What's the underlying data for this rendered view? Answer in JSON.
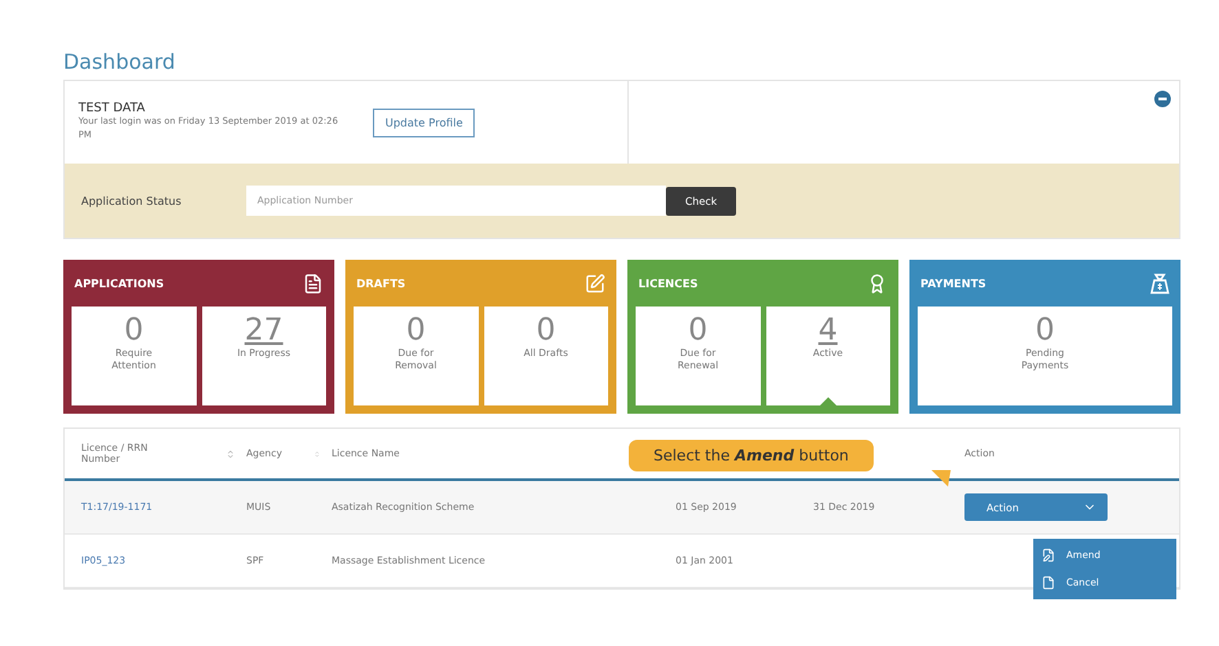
{
  "page_title": "Dashboard",
  "profile": {
    "name": "TEST DATA",
    "last_login": "Your last login was on Friday 13 September 2019 at 02:26 PM",
    "button": "Update Profile"
  },
  "status_check": {
    "label": "Application Status",
    "placeholder": "Application Number",
    "button": "Check"
  },
  "tiles": [
    {
      "title": "APPLICATIONS",
      "color": "#8e2a3a",
      "stats": [
        {
          "value": "0",
          "label": "Require Attention",
          "kind": "plain",
          "selected": false
        },
        {
          "value": "27",
          "label": "In Progress",
          "kind": "link",
          "selected": false
        }
      ]
    },
    {
      "title": "DRAFTS",
      "color": "#e0a02a",
      "stats": [
        {
          "value": "0",
          "label": "Due for Removal",
          "kind": "plain",
          "selected": false
        },
        {
          "value": "0",
          "label": "All Drafts",
          "kind": "plain",
          "selected": false
        }
      ]
    },
    {
      "title": "LICENCES",
      "color": "#5fa544",
      "stats": [
        {
          "value": "0",
          "label": "Due for Renewal",
          "kind": "plain",
          "selected": false
        },
        {
          "value": "4",
          "label": "Active",
          "kind": "link",
          "selected": true
        }
      ]
    },
    {
      "title": "PAYMENTS",
      "color": "#3a8cbc",
      "stats": [
        {
          "value": "0",
          "label": "Pending Payments",
          "kind": "plain",
          "selected": false
        }
      ]
    }
  ],
  "table": {
    "columns": [
      "Licence / RRN Number",
      "Agency",
      "Licence Name",
      "Action"
    ],
    "rows": [
      {
        "number": "T1:17/19-1171",
        "agency": "MUIS",
        "name": "Asatizah Recognition Scheme",
        "start": "01 Sep 2019",
        "end": "31 Dec 2019",
        "action": "Action"
      },
      {
        "number": "IP05_123",
        "agency": "SPF",
        "name": "Massage Establishment Licence",
        "start": "01 Jan 2001"
      }
    ]
  },
  "action_menu": [
    {
      "label": "Amend"
    },
    {
      "label": "Cancel"
    }
  ],
  "tooltip": "Select the **Amend** button"
}
